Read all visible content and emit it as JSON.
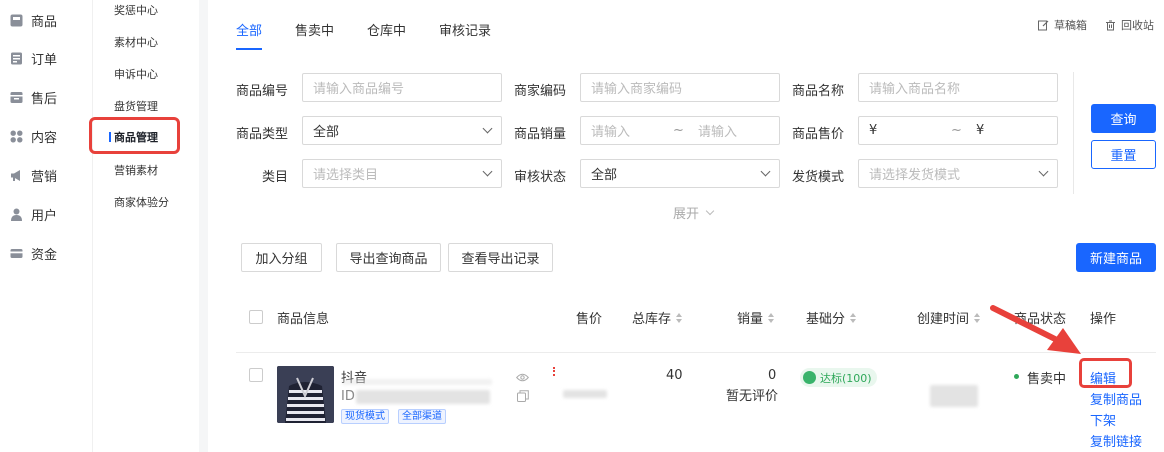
{
  "nav_primary": [
    {
      "label": "商品",
      "icon": "product-icon"
    },
    {
      "label": "订单",
      "icon": "order-icon"
    },
    {
      "label": "售后",
      "icon": "aftersale-icon"
    },
    {
      "label": "内容",
      "icon": "content-icon"
    },
    {
      "label": "营销",
      "icon": "megaphone-icon"
    },
    {
      "label": "用户",
      "icon": "user-icon"
    },
    {
      "label": "资金",
      "icon": "wallet-icon"
    }
  ],
  "nav_secondary": [
    {
      "label": "奖惩中心"
    },
    {
      "label": "素材中心"
    },
    {
      "label": "申诉中心"
    },
    {
      "label": "盘货管理"
    },
    {
      "label": "商品管理",
      "active": true
    },
    {
      "label": "营销素材"
    },
    {
      "label": "商家体验分"
    }
  ],
  "tabs": [
    {
      "label": "全部",
      "active": true
    },
    {
      "label": "售卖中"
    },
    {
      "label": "仓库中"
    },
    {
      "label": "审核记录"
    }
  ],
  "top_links": {
    "drafts": "草稿箱",
    "recycle": "回收站"
  },
  "filters": {
    "product_id": {
      "label": "商品编号",
      "placeholder": "请输入商品编号"
    },
    "merchant_code": {
      "label": "商家编码",
      "placeholder": "请输入商家编码"
    },
    "product_name": {
      "label": "商品名称",
      "placeholder": "请输入商品名称"
    },
    "product_type": {
      "label": "商品类型",
      "value": "全部"
    },
    "sales": {
      "label": "商品销量",
      "placeholder_min": "请输入",
      "sep": "~",
      "placeholder_max": "请输入"
    },
    "price": {
      "label": "商品售价",
      "prefix_min": "¥",
      "sep": "~",
      "prefix_max": "¥"
    },
    "category": {
      "label": "类目",
      "placeholder": "请选择类目"
    },
    "review_status": {
      "label": "审核状态",
      "value": "全部"
    },
    "shipping_mode": {
      "label": "发货模式",
      "placeholder": "请选择发货模式"
    },
    "expand": "展开"
  },
  "buttons": {
    "query": "查询",
    "reset": "重置",
    "add_group": "加入分组",
    "export_query": "导出查询商品",
    "export_records": "查看导出记录",
    "new_product": "新建商品"
  },
  "table": {
    "headers": {
      "info": "商品信息",
      "price": "售价",
      "stock": "总库存",
      "sales": "销量",
      "base_score": "基础分",
      "created": "创建时间",
      "status": "商品状态",
      "ops": "操作"
    },
    "rows": [
      {
        "name": "抖音",
        "id_label": "ID",
        "tags": [
          "现货模式",
          "全部渠道"
        ],
        "stock": "40",
        "sales": "0",
        "rating": "暂无评价",
        "score_badge": "达标(100)",
        "status": "售卖中",
        "ops": [
          "编辑",
          "复制商品",
          "下架",
          "复制链接"
        ]
      }
    ]
  },
  "colors": {
    "accent": "#1966ff",
    "annotation": "#e8413b",
    "status_dot": "#2fa85a"
  }
}
